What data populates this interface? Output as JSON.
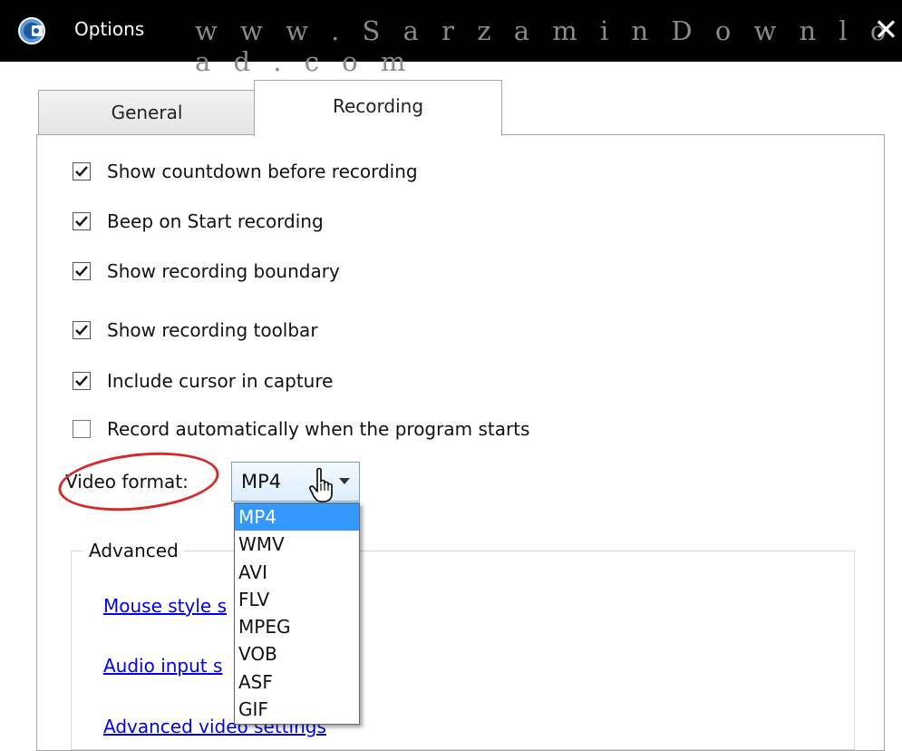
{
  "window": {
    "title": "Options",
    "watermark": "w w w . S a r z a m i n D o w n l o a d . c o m",
    "close_label": "✕"
  },
  "tabs": [
    {
      "label": "General",
      "active": false
    },
    {
      "label": "Recording",
      "active": true
    }
  ],
  "checkboxes": [
    {
      "label": "Show countdown before recording",
      "checked": true
    },
    {
      "label": "Beep on Start recording",
      "checked": true
    },
    {
      "label": "Show recording boundary",
      "checked": true
    },
    {
      "label": "Show recording toolbar",
      "checked": true
    },
    {
      "label": "Include cursor in capture",
      "checked": true
    },
    {
      "label": "Record automatically when the program starts",
      "checked": false
    }
  ],
  "video_format": {
    "label": "Video format:",
    "selected": "MP4",
    "options": [
      "MP4",
      "WMV",
      "AVI",
      "FLV",
      "MPEG",
      "VOB",
      "ASF",
      "GIF"
    ]
  },
  "advanced": {
    "legend": "Advanced",
    "links": [
      "Mouse style s",
      "Audio input s",
      "Advanced video settings"
    ]
  },
  "colors": {
    "titlebar": "#000000",
    "highlight": "#3399ff",
    "annotation_circle": "#d42a2a",
    "link": "#0000ee"
  },
  "icons": {
    "app": "webcam-app-icon",
    "close": "close-icon",
    "cursor": "hand-pointer-icon",
    "dropdown": "chevron-down-icon",
    "check": "checkmark-icon"
  }
}
